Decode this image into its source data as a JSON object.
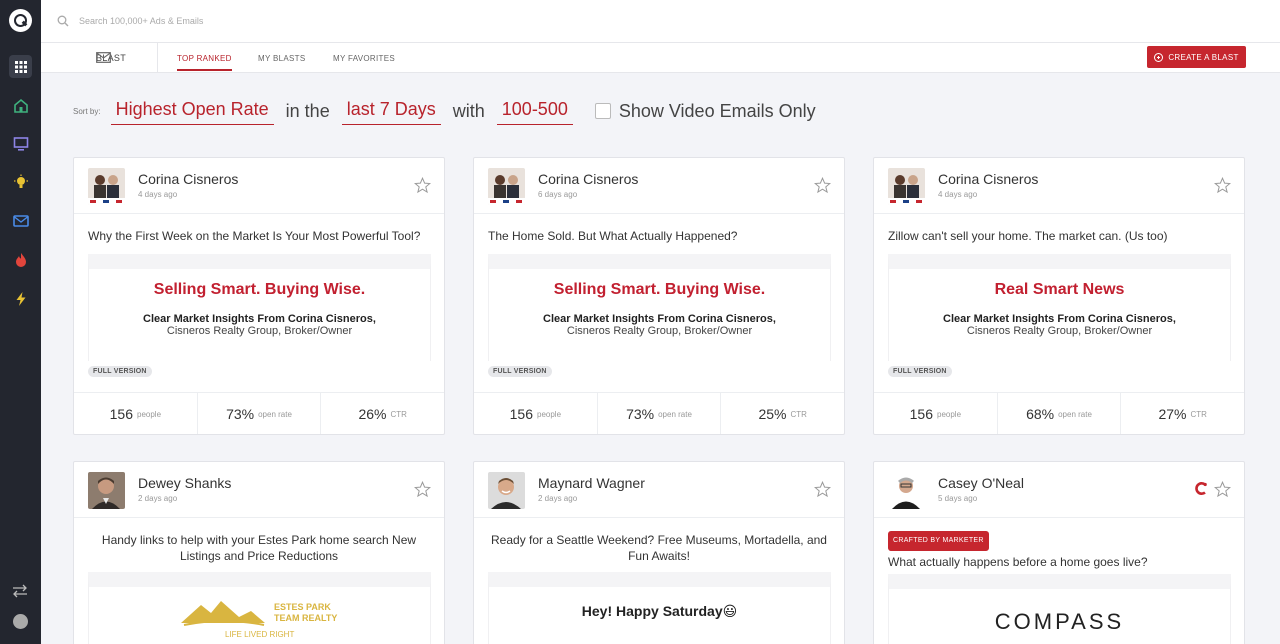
{
  "search": {
    "placeholder": "Search 100,000+ Ads & Emails"
  },
  "subnav": {
    "blast_label": "BLAST",
    "tabs": [
      {
        "label": "TOP RANKED",
        "active": true
      },
      {
        "label": "MY BLASTS",
        "active": false
      },
      {
        "label": "MY FAVORITES",
        "active": false
      }
    ],
    "create_label": "CREATE A BLAST"
  },
  "filters": {
    "sort_by_label": "Sort by:",
    "sort_value": "Highest Open Rate",
    "in_the": "in the",
    "period_value": "last 7 Days",
    "with": "with",
    "range_value": "100-500",
    "video_label": "Show Video Emails Only"
  },
  "colors": {
    "accent": "#c6262e",
    "rail": "#23262f"
  },
  "cards": [
    {
      "name": "Corina Cisneros",
      "ago": "4 days ago",
      "subject": "Why the First Week on the Market Is Your Most Powerful Tool?",
      "preview_headline": "Selling Smart. Buying Wise.",
      "preview_line1": "Clear Market Insights From Corina Cisneros,",
      "preview_line2": "Cisneros Realty Group, Broker/Owner",
      "badge": "FULL VERSION",
      "people": "156",
      "people_label": "people",
      "open_rate": "73%",
      "open_label": "open rate",
      "ctr": "26%",
      "ctr_label": "CTR"
    },
    {
      "name": "Corina Cisneros",
      "ago": "6 days ago",
      "subject": "The Home Sold. But What Actually Happened?",
      "preview_headline": "Selling Smart. Buying Wise.",
      "preview_line1": "Clear Market Insights From Corina Cisneros,",
      "preview_line2": "Cisneros Realty Group, Broker/Owner",
      "badge": "FULL VERSION",
      "people": "156",
      "people_label": "people",
      "open_rate": "73%",
      "open_label": "open rate",
      "ctr": "25%",
      "ctr_label": "CTR"
    },
    {
      "name": "Corina Cisneros",
      "ago": "4 days ago",
      "subject": "Zillow can't sell your home. The market can. (Us too)",
      "preview_headline": "Real Smart News",
      "preview_line1": "Clear Market Insights From Corina Cisneros,",
      "preview_line2": "Cisneros Realty Group, Broker/Owner",
      "badge": "FULL VERSION",
      "people": "156",
      "people_label": "people",
      "open_rate": "68%",
      "open_label": "open rate",
      "ctr": "27%",
      "ctr_label": "CTR"
    },
    {
      "name": "Dewey Shanks",
      "ago": "2 days ago",
      "subject": "Handy links to help with your Estes Park home search New Listings and Price Reductions",
      "preview_brand1": "ESTES PARK",
      "preview_brand2": "TEAM REALTY",
      "preview_brand3": "LIFE LIVED RIGHT"
    },
    {
      "name": "Maynard Wagner",
      "ago": "2 days ago",
      "subject": "Ready for a Seattle Weekend? Free Museums, Mortadella, and Fun Awaits!",
      "preview_headline": "Hey! Happy Saturday😃"
    },
    {
      "name": "Casey O'Neal",
      "ago": "5 days ago",
      "crafted_badge": "CRAFTED BY MARKETER",
      "subject": "What actually happens before a home goes live?",
      "preview_brand": "COMPASS"
    }
  ]
}
